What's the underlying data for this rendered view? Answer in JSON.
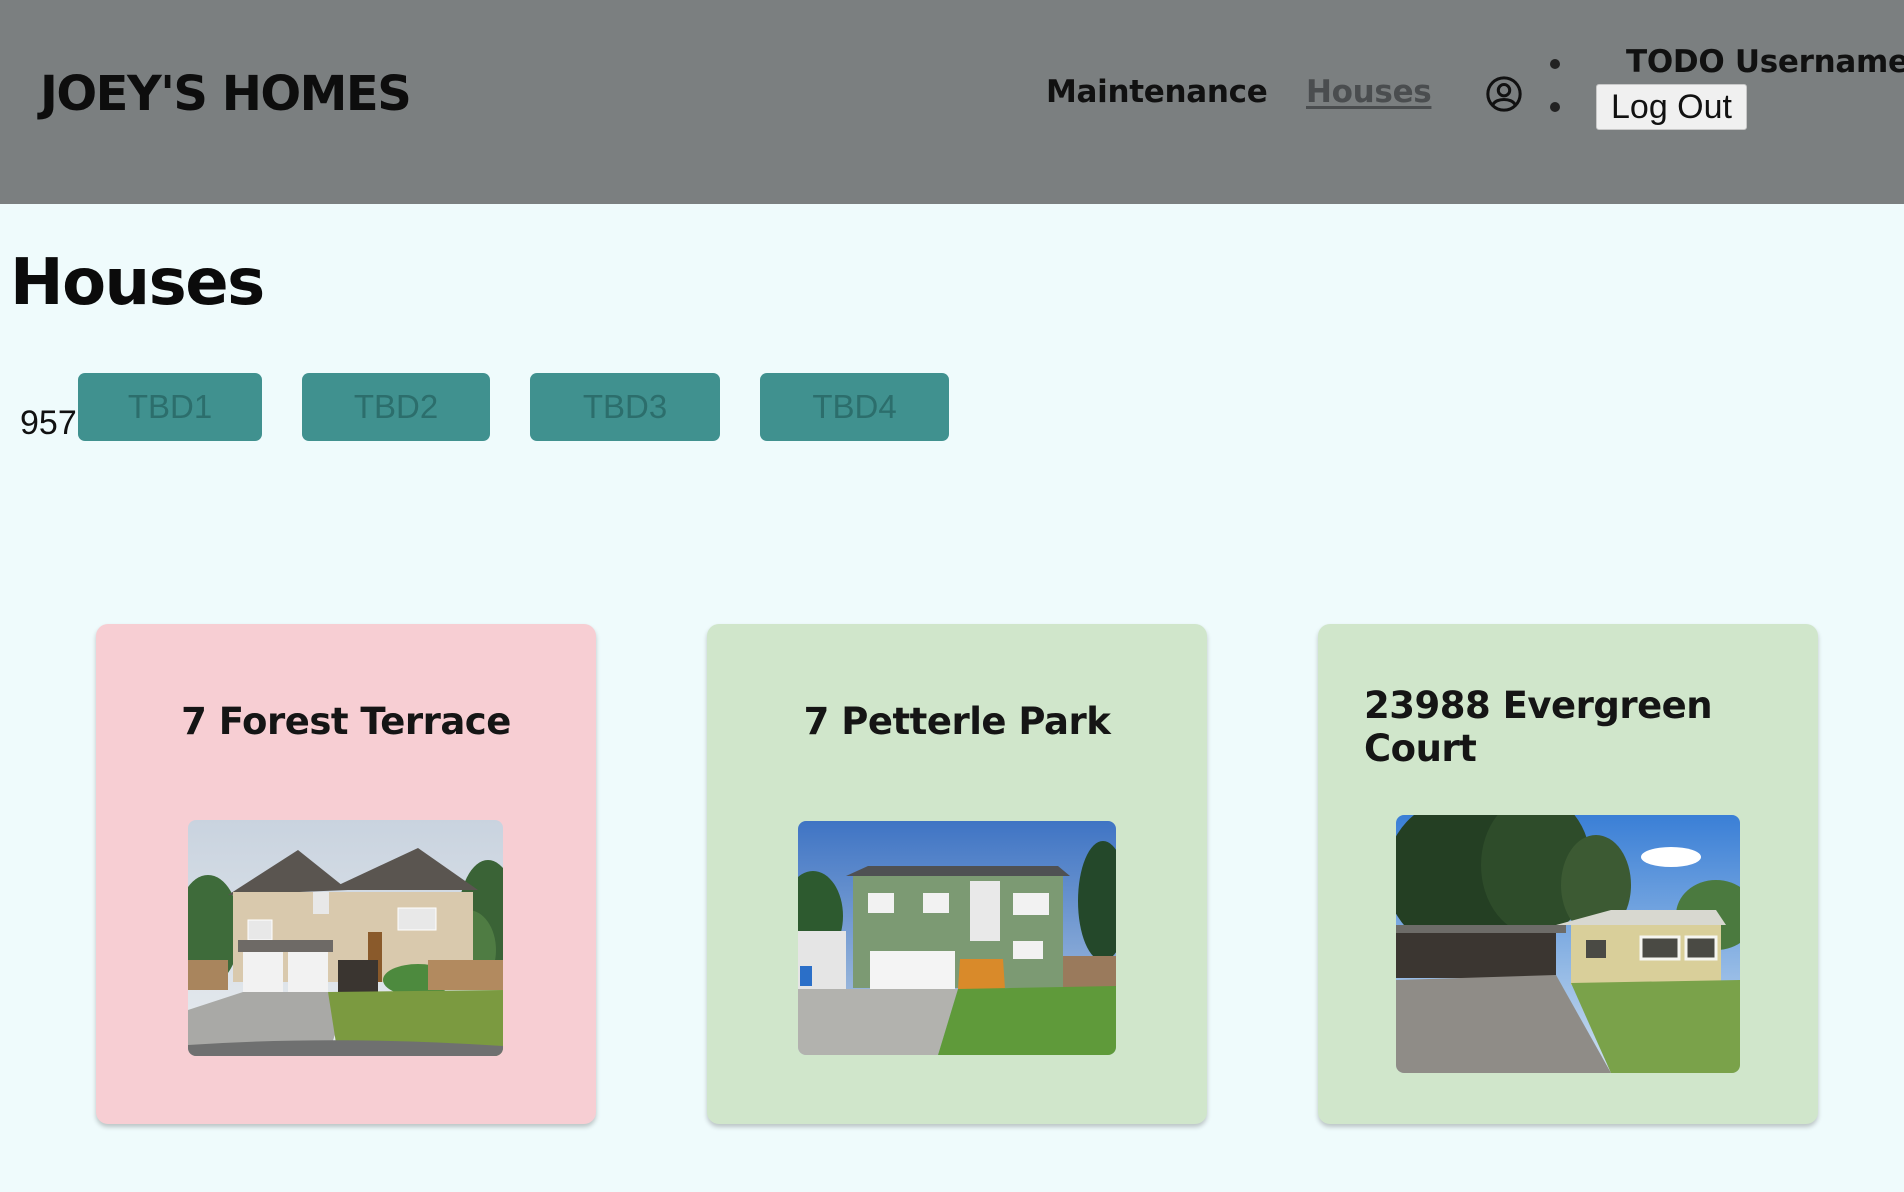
{
  "header": {
    "brand": "JOEY'S HOMES",
    "nav": [
      {
        "label": "Maintenance"
      },
      {
        "label": "Houses"
      }
    ],
    "user": {
      "icon": "user-circle-icon",
      "username": "TODO Username",
      "logout_label": "Log Out"
    }
  },
  "main": {
    "title": "Houses",
    "count": "957",
    "filters": [
      {
        "label": "TBD1"
      },
      {
        "label": "TBD2"
      },
      {
        "label": "TBD3"
      },
      {
        "label": "TBD4"
      }
    ],
    "cards": [
      {
        "title": "7 Forest Terrace",
        "color": "#f7ced3"
      },
      {
        "title": "7 Petterle Park",
        "color": "#d0e6cb"
      },
      {
        "title": "23988 Evergreen Court",
        "color": "#d0e6cb"
      }
    ]
  },
  "colors": {
    "header_bg": "#7b7f80",
    "page_bg": "#effbfc",
    "filter_button": "#40918f"
  }
}
